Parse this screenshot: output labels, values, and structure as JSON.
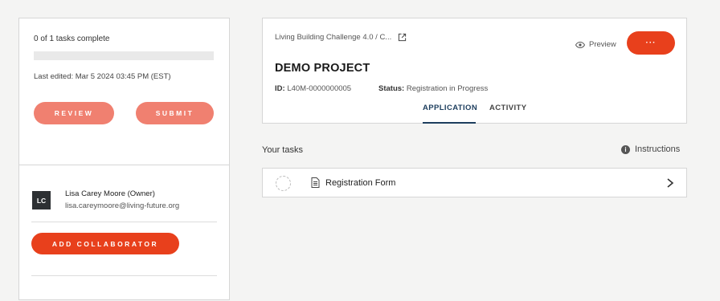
{
  "sidebar": {
    "progress_text": "0 of 1 tasks complete",
    "progress_fraction": 0,
    "last_edited": "Last edited: Mar 5 2024 03:45 PM (EST)",
    "review_label": "REVIEW",
    "submit_label": "SUBMIT",
    "owner": {
      "initials": "LC",
      "name": "Lisa Carey Moore (Owner)",
      "email": "lisa.careymoore@living-future.org"
    },
    "add_collaborator_label": "ADD COLLABORATOR"
  },
  "project": {
    "breadcrumb": "Living Building Challenge 4.0 / C...",
    "preview_label": "Preview",
    "more_label": "···",
    "title": "DEMO PROJECT",
    "id_label": "ID:",
    "id_value": "L40M-0000000005",
    "status_label": "Status:",
    "status_value": "Registration in Progress",
    "tabs": [
      {
        "label": "APPLICATION",
        "active": true
      },
      {
        "label": "ACTIVITY",
        "active": false
      }
    ]
  },
  "tasks": {
    "title": "Your tasks",
    "instructions_label": "Instructions",
    "items": [
      {
        "label": "Registration Form"
      }
    ]
  },
  "colors": {
    "accent": "#e8401c",
    "accent_light": "#f08070",
    "tab_active": "#1d3e5e"
  },
  "icons": {
    "external_link": "external-link-icon",
    "preview": "eye-icon",
    "info": "info-icon",
    "document": "document-icon",
    "chevron": "chevron-right-icon"
  }
}
